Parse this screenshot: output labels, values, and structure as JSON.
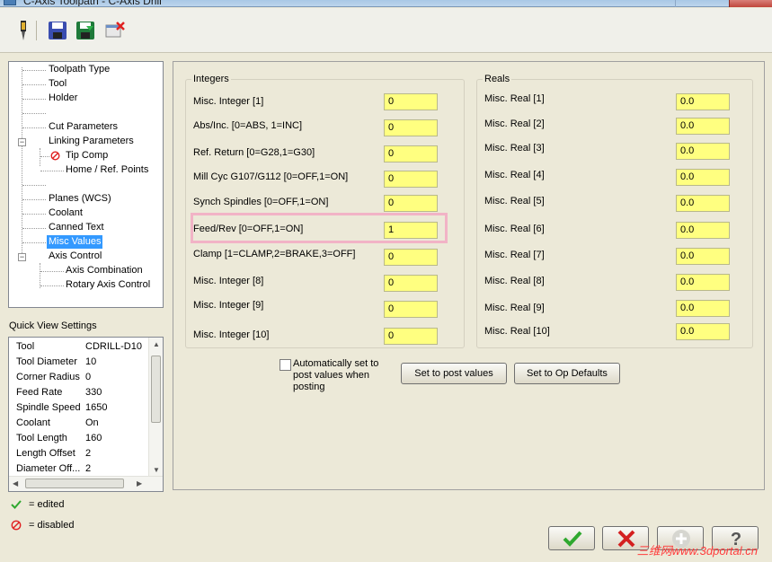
{
  "window": {
    "title": "C-Axis Toolpath - C-Axis Drill"
  },
  "toolbar": {
    "icons": [
      "tool-icon",
      "save-icon",
      "save-as-icon",
      "delete-icon"
    ]
  },
  "tree": {
    "items": [
      {
        "label": "Toolpath Type"
      },
      {
        "label": "Tool"
      },
      {
        "label": "Holder"
      },
      {
        "label": ""
      },
      {
        "label": "Cut Parameters"
      },
      {
        "label": "Linking Parameters"
      },
      {
        "label": "Tip Comp"
      },
      {
        "label": "Home / Ref. Points"
      },
      {
        "label": ""
      },
      {
        "label": "Planes (WCS)"
      },
      {
        "label": "Coolant"
      },
      {
        "label": "Canned Text"
      },
      {
        "label": "Misc Values",
        "selected": true
      },
      {
        "label": "Axis Control"
      },
      {
        "label": "Axis Combination"
      },
      {
        "label": "Rotary Axis Control"
      }
    ]
  },
  "quick_view": {
    "title": "Quick View Settings",
    "rows": [
      {
        "key": "Tool",
        "value": "CDRILL-D10"
      },
      {
        "key": "Tool Diameter",
        "value": "10"
      },
      {
        "key": "Corner Radius",
        "value": "0"
      },
      {
        "key": "Feed Rate",
        "value": "330"
      },
      {
        "key": "Spindle Speed",
        "value": "1650"
      },
      {
        "key": "Coolant",
        "value": "On"
      },
      {
        "key": "Tool Length",
        "value": "160"
      },
      {
        "key": "Length Offset",
        "value": "2"
      },
      {
        "key": "Diameter Off...",
        "value": "2"
      }
    ]
  },
  "legend": {
    "edited": "= edited",
    "disabled": "= disabled"
  },
  "integers": {
    "title": "Integers",
    "fields": [
      {
        "label": "Misc. Integer [1]",
        "value": "0"
      },
      {
        "label": "Abs/Inc. [0=ABS, 1=INC]",
        "value": "0"
      },
      {
        "label": "Ref. Return [0=G28,1=G30]",
        "value": "0"
      },
      {
        "label": "Mill Cyc G107/G112 [0=OFF,1=ON]",
        "value": "0"
      },
      {
        "label": "Synch Spindles [0=OFF,1=ON]",
        "value": "0"
      },
      {
        "label": "Feed/Rev [0=OFF,1=ON]",
        "value": "1"
      },
      {
        "label": "Clamp [1=CLAMP,2=BRAKE,3=OFF]",
        "value": "0"
      },
      {
        "label": "Misc. Integer [8]",
        "value": "0"
      },
      {
        "label": "Misc. Integer [9]",
        "value": "0"
      },
      {
        "label": "Misc. Integer [10]",
        "value": "0"
      }
    ]
  },
  "reals": {
    "title": "Reals",
    "fields": [
      {
        "label": "Misc. Real [1]",
        "value": "0.0"
      },
      {
        "label": "Misc. Real [2]",
        "value": "0.0"
      },
      {
        "label": "Misc. Real [3]",
        "value": "0.0"
      },
      {
        "label": "Misc. Real [4]",
        "value": "0.0"
      },
      {
        "label": "Misc. Real [5]",
        "value": "0.0"
      },
      {
        "label": "Misc. Real [6]",
        "value": "0.0"
      },
      {
        "label": "Misc. Real [7]",
        "value": "0.0"
      },
      {
        "label": "Misc. Real [8]",
        "value": "0.0"
      },
      {
        "label": "Misc. Real [9]",
        "value": "0.0"
      },
      {
        "label": "Misc. Real [10]",
        "value": "0.0"
      }
    ]
  },
  "options": {
    "auto_set_label": "Automatically set to post values when posting",
    "auto_set_checked": false,
    "set_post_values_label": "Set to post values",
    "set_op_defaults_label": "Set to Op Defaults"
  },
  "dialog_buttons": [
    "ok-icon",
    "cancel-icon",
    "add-icon",
    "help-icon"
  ],
  "colors": {
    "field_bg": "#ffff80",
    "selection": "#3399ff",
    "highlight_box": "#f2b3c6",
    "ok": "#2fa82f",
    "cancel": "#d42020"
  },
  "watermark": "三维网www.3dportal.cn"
}
